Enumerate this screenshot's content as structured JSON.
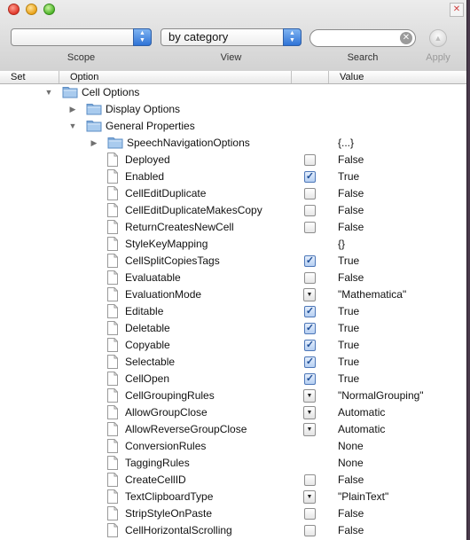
{
  "window": {
    "close_icon": "close-light-icon",
    "minimize_icon": "minimize-light-icon",
    "zoom_icon": "zoom-light-icon",
    "corner_close_glyph": "✕"
  },
  "toolbar": {
    "scope": {
      "value": "",
      "label": "Scope"
    },
    "view": {
      "value": "by category",
      "label": "View"
    },
    "search": {
      "value": "",
      "placeholder": "",
      "label": "Search"
    },
    "apply": {
      "label": "Apply"
    }
  },
  "columns": {
    "set": "Set",
    "option": "Option",
    "value": "Value"
  },
  "rows": [
    {
      "level": 0,
      "kind": "folder",
      "expanded": true,
      "name": "Cell Options",
      "value": ""
    },
    {
      "level": 1,
      "kind": "folder",
      "expanded": false,
      "name": "Display Options",
      "value": ""
    },
    {
      "level": 1,
      "kind": "folder",
      "expanded": true,
      "name": "General Properties",
      "value": ""
    },
    {
      "level": 2,
      "kind": "folder",
      "expanded": false,
      "name": "SpeechNavigationOptions",
      "value": "{...}"
    },
    {
      "level": 2,
      "kind": "doc",
      "control": "checkbox",
      "checked": false,
      "name": "Deployed",
      "value": "False"
    },
    {
      "level": 2,
      "kind": "doc",
      "control": "checkbox",
      "checked": true,
      "name": "Enabled",
      "value": "True"
    },
    {
      "level": 2,
      "kind": "doc",
      "control": "checkbox",
      "checked": false,
      "name": "CellEditDuplicate",
      "value": "False"
    },
    {
      "level": 2,
      "kind": "doc",
      "control": "checkbox",
      "checked": false,
      "name": "CellEditDuplicateMakesCopy",
      "value": "False"
    },
    {
      "level": 2,
      "kind": "doc",
      "control": "checkbox",
      "checked": false,
      "name": "ReturnCreatesNewCell",
      "value": "False"
    },
    {
      "level": 2,
      "kind": "doc",
      "control": "none",
      "name": "StyleKeyMapping",
      "value": "{}"
    },
    {
      "level": 2,
      "kind": "doc",
      "control": "checkbox",
      "checked": true,
      "name": "CellSplitCopiesTags",
      "value": "True"
    },
    {
      "level": 2,
      "kind": "doc",
      "control": "checkbox",
      "checked": false,
      "name": "Evaluatable",
      "value": "False"
    },
    {
      "level": 2,
      "kind": "doc",
      "control": "dropdown",
      "name": "EvaluationMode",
      "value": "\"Mathematica\""
    },
    {
      "level": 2,
      "kind": "doc",
      "control": "checkbox",
      "checked": true,
      "name": "Editable",
      "value": "True"
    },
    {
      "level": 2,
      "kind": "doc",
      "control": "checkbox",
      "checked": true,
      "name": "Deletable",
      "value": "True"
    },
    {
      "level": 2,
      "kind": "doc",
      "control": "checkbox",
      "checked": true,
      "name": "Copyable",
      "value": "True"
    },
    {
      "level": 2,
      "kind": "doc",
      "control": "checkbox",
      "checked": true,
      "name": "Selectable",
      "value": "True"
    },
    {
      "level": 2,
      "kind": "doc",
      "control": "checkbox",
      "checked": true,
      "name": "CellOpen",
      "value": "True"
    },
    {
      "level": 2,
      "kind": "doc",
      "control": "dropdown",
      "name": "CellGroupingRules",
      "value": "\"NormalGrouping\""
    },
    {
      "level": 2,
      "kind": "doc",
      "control": "dropdown",
      "name": "AllowGroupClose",
      "value": "Automatic"
    },
    {
      "level": 2,
      "kind": "doc",
      "control": "dropdown",
      "name": "AllowReverseGroupClose",
      "value": "Automatic"
    },
    {
      "level": 2,
      "kind": "doc",
      "control": "none",
      "name": "ConversionRules",
      "value": "None"
    },
    {
      "level": 2,
      "kind": "doc",
      "control": "none",
      "name": "TaggingRules",
      "value": "None"
    },
    {
      "level": 2,
      "kind": "doc",
      "control": "checkbox",
      "checked": false,
      "name": "CreateCellID",
      "value": "False"
    },
    {
      "level": 2,
      "kind": "doc",
      "control": "dropdown",
      "name": "TextClipboardType",
      "value": "\"PlainText\""
    },
    {
      "level": 2,
      "kind": "doc",
      "control": "checkbox",
      "checked": false,
      "name": "StripStyleOnPaste",
      "value": "False"
    },
    {
      "level": 2,
      "kind": "doc",
      "control": "checkbox",
      "checked": false,
      "name": "CellHorizontalScrolling",
      "value": "False"
    }
  ]
}
